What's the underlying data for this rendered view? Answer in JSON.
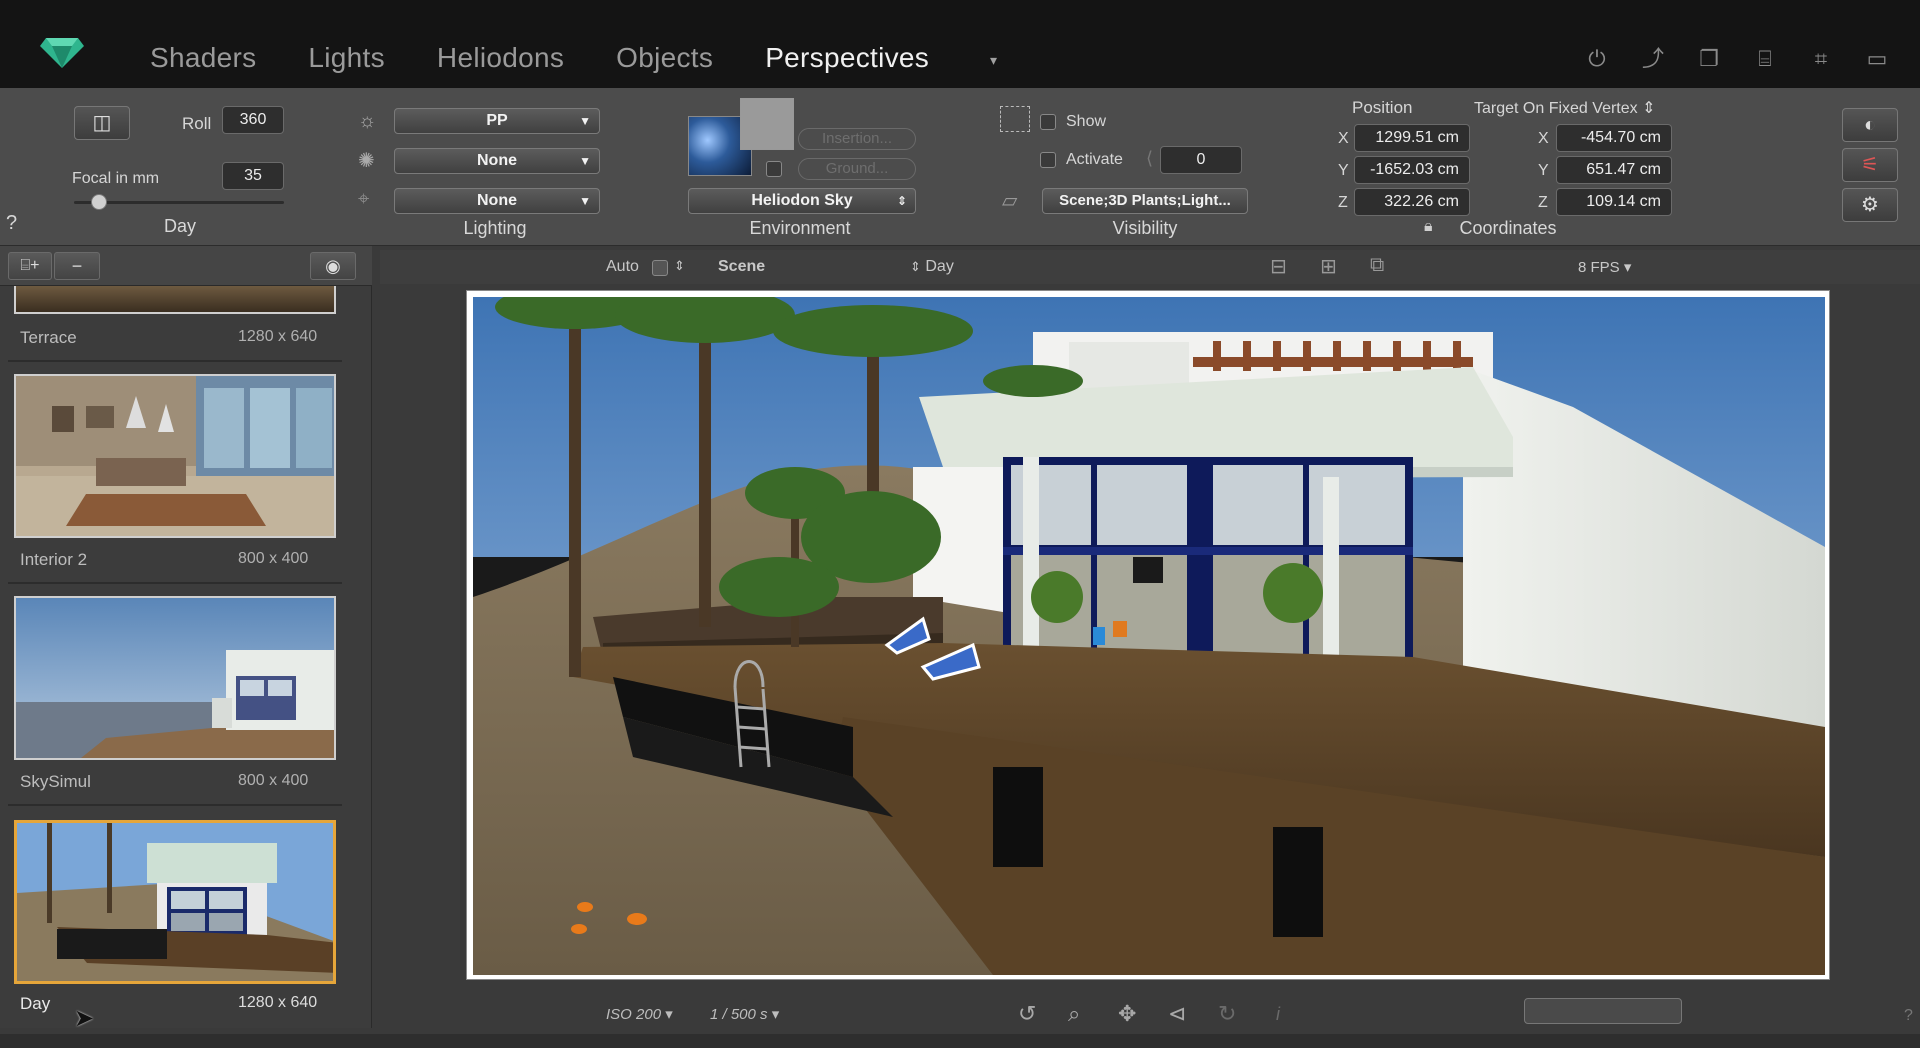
{
  "nav": {
    "tabs": [
      "Shaders",
      "Lights",
      "Heliodons",
      "Objects",
      "Perspectives"
    ],
    "active_tab": "Perspectives",
    "dropdown_glyph": "▾",
    "top_icons": [
      "power-icon",
      "transform-icon",
      "window-icon",
      "camera-icon",
      "crop-icon",
      "display-icon"
    ]
  },
  "camera": {
    "roll_label": "Roll",
    "roll_value": "360",
    "focal_label": "Focal in mm",
    "focal_value": "35",
    "caption": "Day",
    "help": "?"
  },
  "lighting": {
    "sun_value": "PP",
    "bulb_value": "None",
    "light_value": "None",
    "caption": "Lighting"
  },
  "environment": {
    "insertion_label": "Insertion...",
    "ground_label": "Ground...",
    "sky_value": "Heliodon Sky",
    "caption": "Environment"
  },
  "visibility": {
    "show_label": "Show",
    "activate_label": "Activate",
    "activate_value": "0",
    "layers_value": "Scene;3D Plants;Light...",
    "caption": "Visibility"
  },
  "coordinates": {
    "position_label": "Position",
    "target_label": "Target On Fixed Vertex",
    "pos_x": "1299.51 cm",
    "pos_y": "-1652.03 cm",
    "pos_z": "322.26 cm",
    "tgt_x": "-454.70 cm",
    "tgt_y": "651.47 cm",
    "tgt_z": "109.14 cm",
    "axis_x": "X",
    "axis_y": "Y",
    "axis_z": "Z",
    "caption": "Coordinates"
  },
  "sidebar": {
    "items": [
      {
        "name": "Terrace",
        "size": "1280 x 640"
      },
      {
        "name": "Interior 2",
        "size": "800 x 400"
      },
      {
        "name": "SkySimul",
        "size": "800 x 400"
      },
      {
        "name": "Day",
        "size": "1280 x 640"
      }
    ],
    "selected": "Day"
  },
  "viewbar": {
    "auto_label": "Auto",
    "scene_label": "Scene",
    "heliodon_label": "Day",
    "fps_label": "8 FPS"
  },
  "bottombar": {
    "iso": "ISO 200",
    "shutter": "1 / 500 s",
    "info_glyph": "i",
    "help": "?"
  },
  "colors": {
    "accent_selected": "#e6a63a",
    "logo_green": "#2fb58e"
  }
}
